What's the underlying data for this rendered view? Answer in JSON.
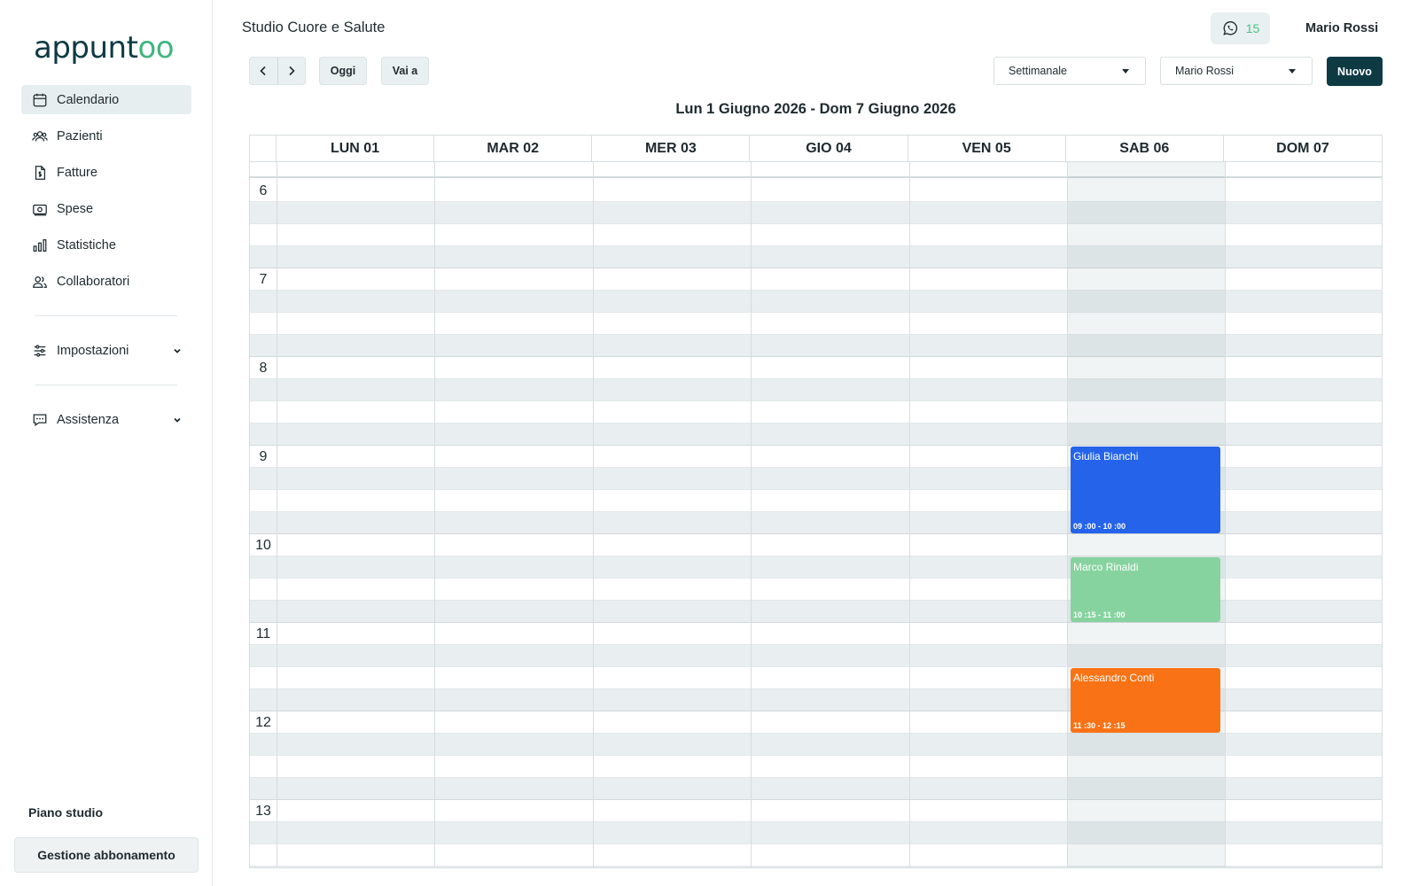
{
  "app": {
    "logo_text": "appuntoo",
    "studio_name": "Studio Cuore e Salute",
    "whatsapp_count": "15",
    "user_name": "Mario Rossi"
  },
  "sidebar": {
    "items": [
      {
        "label": "Calendario",
        "icon": "calendar-icon",
        "active": true
      },
      {
        "label": "Pazienti",
        "icon": "users-icon"
      },
      {
        "label": "Fatture",
        "icon": "invoice-icon"
      },
      {
        "label": "Spese",
        "icon": "money-icon"
      },
      {
        "label": "Statistiche",
        "icon": "chart-icon"
      },
      {
        "label": "Collaboratori",
        "icon": "collaborators-icon"
      }
    ],
    "settings_label": "Impostazioni",
    "support_label": "Assistenza",
    "plan_title": "Piano studio",
    "subscription_button": "Gestione abbonamento"
  },
  "toolbar": {
    "today_label": "Oggi",
    "goto_label": "Vai a",
    "view_select": "Settimanale",
    "staff_select": "Mario Rossi",
    "new_label": "Nuovo"
  },
  "calendar": {
    "range_title": "Lun 1 Giugno 2026 - Dom 7 Giugno 2026",
    "days": [
      "LUN 01",
      "MAR 02",
      "MER 03",
      "GIO 04",
      "VEN 05",
      "SAB 06",
      "DOM 07"
    ],
    "hours": [
      "6",
      "7",
      "8",
      "9",
      "10",
      "11",
      "12",
      "13"
    ],
    "appointments": [
      {
        "name": "Giulia Bianchi",
        "time": "09 :00 - 10 :00",
        "day": "SAB 06",
        "start": "09:00",
        "end": "10:00",
        "color": "#2563eb"
      },
      {
        "name": "Marco Rinaldi",
        "time": "10 :15 - 11 :00",
        "day": "SAB 06",
        "start": "10:15",
        "end": "11:00",
        "color": "#86d39f"
      },
      {
        "name": "Alessandro Conti",
        "time": "11 :30 - 12 :15",
        "day": "SAB 06",
        "start": "11:30",
        "end": "12:15",
        "color": "#f97316"
      }
    ]
  }
}
